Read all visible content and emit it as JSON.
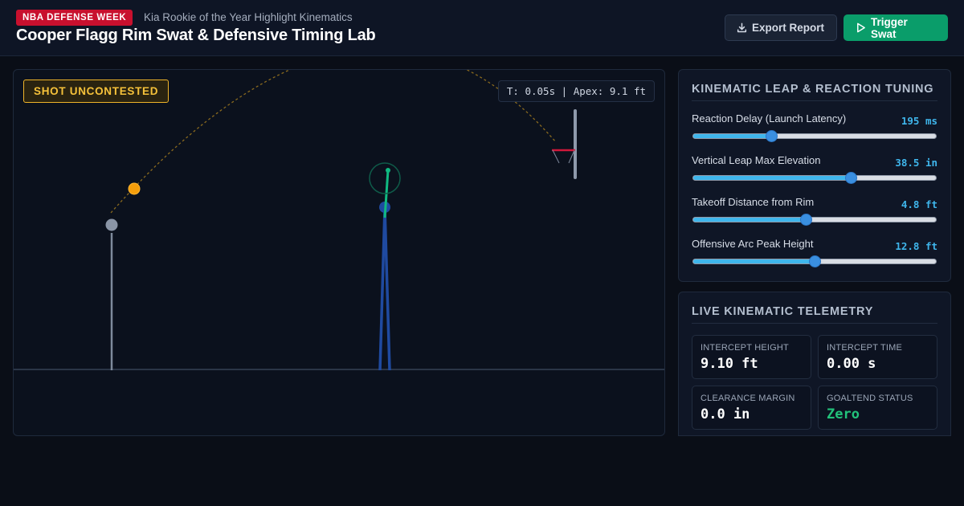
{
  "header": {
    "badge": "NBA DEFENSE WEEK",
    "subtitle": "Kia Rookie of the Year Highlight Kinematics",
    "title": "Cooper Flagg Rim Swat & Defensive Timing Lab",
    "export_label": "Export Report",
    "swat_label": "Trigger Swat"
  },
  "court": {
    "shot_status": "SHOT UNCONTESTED",
    "readout": "T: 0.05s | Apex: 9.1 ft"
  },
  "tuning": {
    "title": "KINEMATIC LEAP & REACTION TUNING",
    "sliders": [
      {
        "label": "Reaction Delay (Launch Latency)",
        "value": "195 ms",
        "fraction": 0.32
      },
      {
        "label": "Vertical Leap Max Elevation",
        "value": "38.5 in",
        "fraction": 0.65
      },
      {
        "label": "Takeoff Distance from Rim",
        "value": "4.8 ft",
        "fraction": 0.465
      },
      {
        "label": "Offensive Arc Peak Height",
        "value": "12.8 ft",
        "fraction": 0.5
      }
    ]
  },
  "telemetry": {
    "title": "LIVE KINEMATIC TELEMETRY",
    "metrics": [
      {
        "label": "INTERCEPT HEIGHT",
        "value": "9.10 ft"
      },
      {
        "label": "INTERCEPT TIME",
        "value": "0.00 s"
      },
      {
        "label": "CLEARANCE MARGIN",
        "value": "0.0 in"
      },
      {
        "label": "GOALTEND STATUS",
        "value": "Zero"
      }
    ]
  },
  "colors": {
    "badge": "#c8102e",
    "accent": "#3fb6ec",
    "success": "#0a9d6a",
    "warning": "#f0b429",
    "goaltend_ok": "#22c27a"
  },
  "icons": {
    "export": "download-icon",
    "swat": "play-icon"
  }
}
